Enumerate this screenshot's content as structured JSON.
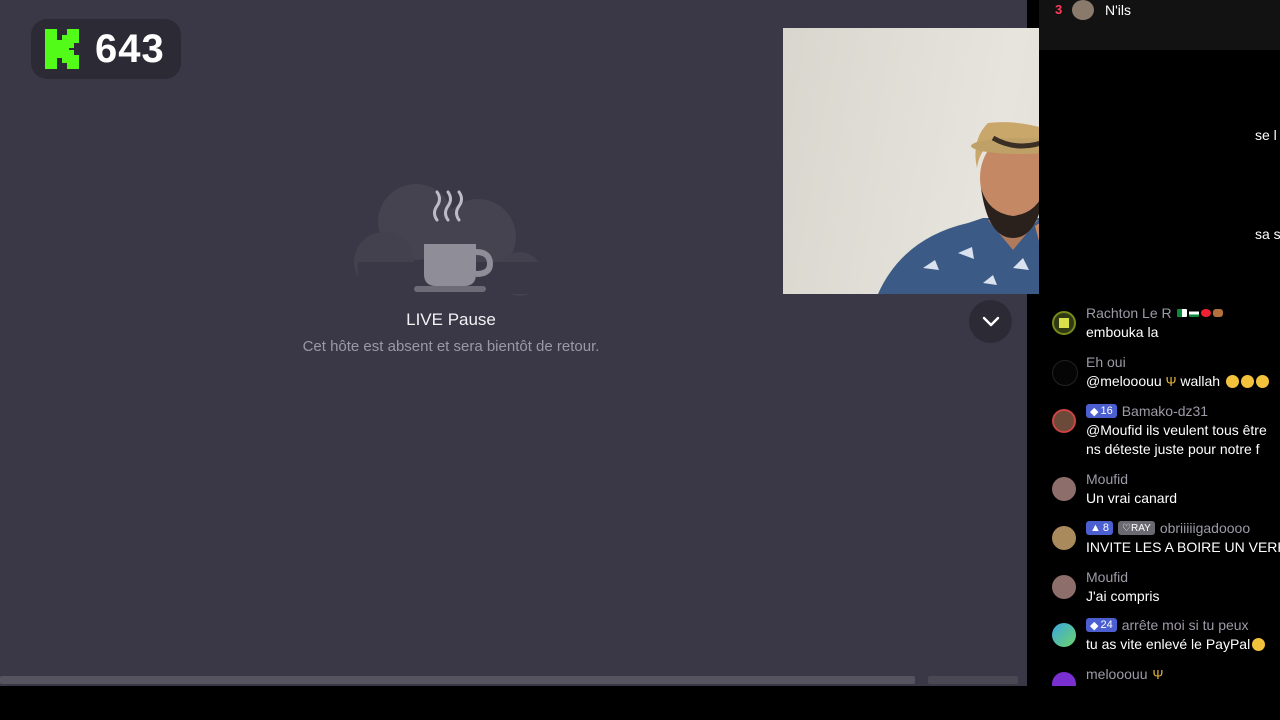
{
  "stream": {
    "viewer_count": "643",
    "pause_title": "LIVE Pause",
    "pause_subtitle": "Cet hôte est absent et sera bientôt de retour."
  },
  "chat": {
    "top_rank": {
      "rank": "3",
      "name": "N'ils"
    },
    "partial_messages": [
      "se l",
      "sa sv"
    ],
    "messages": [
      {
        "name": "Rachton Le R",
        "text": "embouka la"
      },
      {
        "name": "Eh oui",
        "text": "@melooouu",
        "text_suffix": "wallah"
      },
      {
        "badge": "16",
        "name": "Bamako-dz31",
        "text": "@Moufid ils veulent tous être",
        "text2": "ns déteste juste pour notre f"
      },
      {
        "name": "Moufid",
        "text": "Un vrai canard"
      },
      {
        "badge": "8",
        "badge2": "RAY",
        "name": "obriiiiigadoooo",
        "text": "INVITE LES A BOIRE UN VERR"
      },
      {
        "name": "Moufid",
        "text": "J'ai compris"
      },
      {
        "badge": "24",
        "name": "arrête moi si tu peux",
        "text": "tu as vite enlevé le PayPal"
      },
      {
        "name": "melooouu"
      }
    ]
  },
  "colors": {
    "stage_bg": "#3a3846",
    "kick_green": "#53fc18",
    "level_badge": "#4b5fd1",
    "rank_red": "#ff3b5c"
  }
}
